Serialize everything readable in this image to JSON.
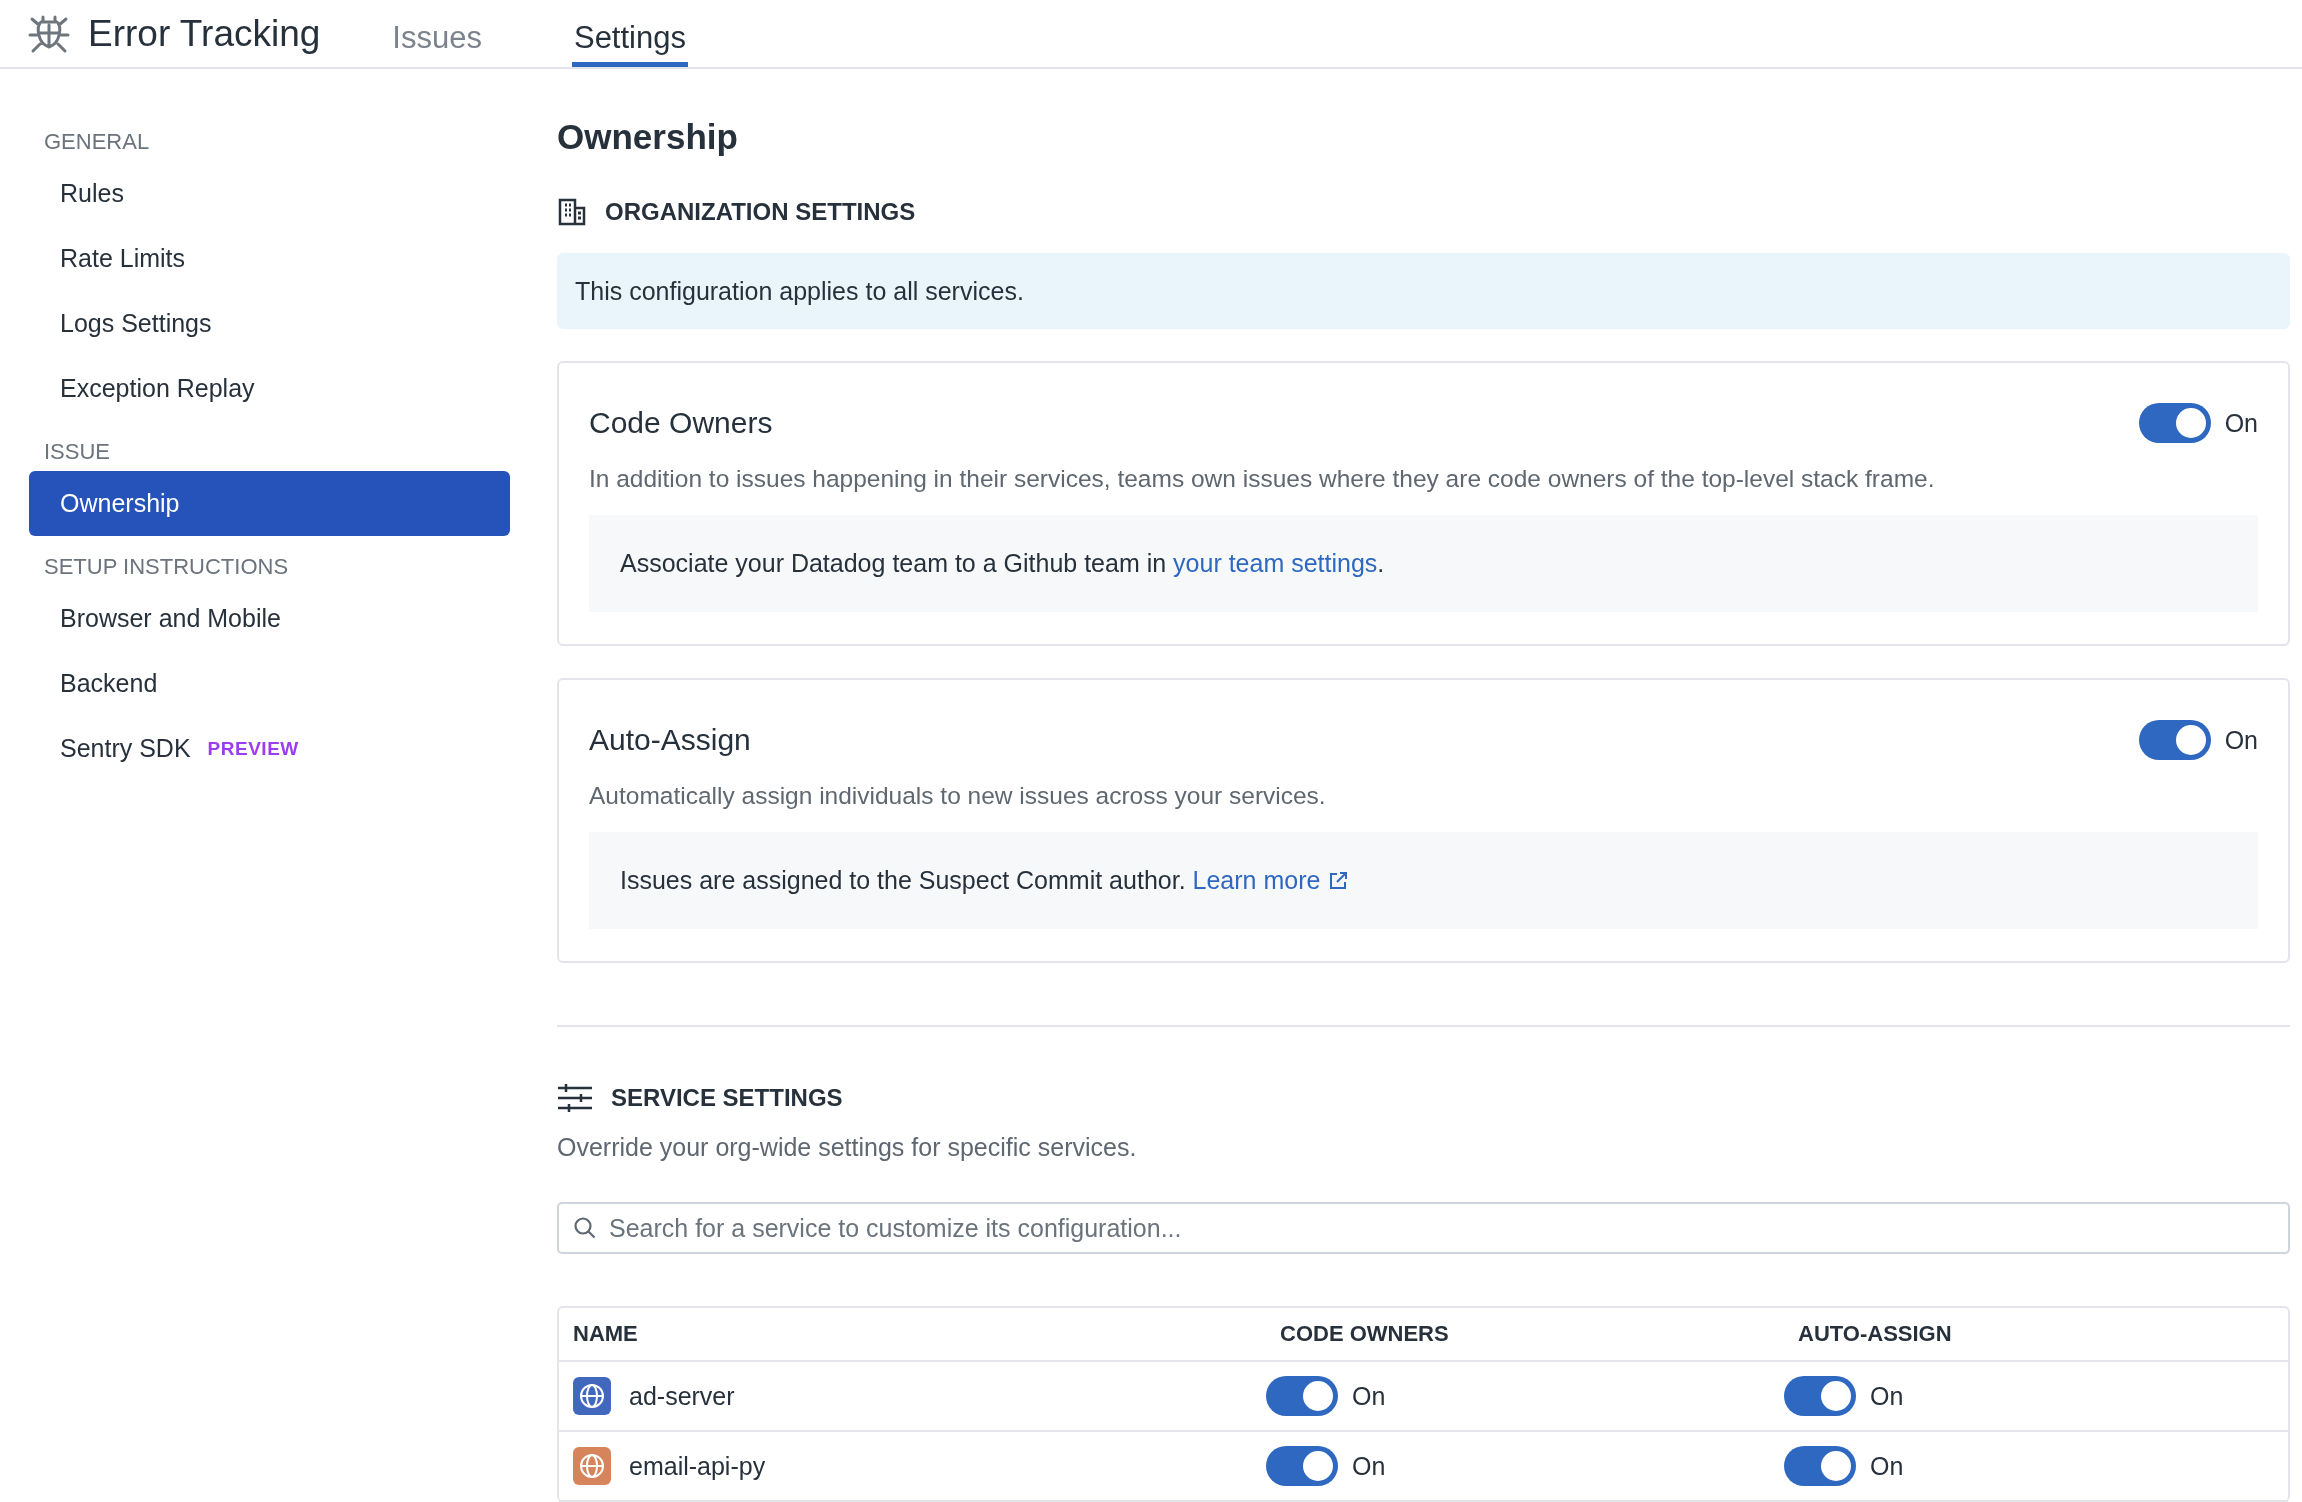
{
  "app": {
    "title": "Error Tracking"
  },
  "tabs": [
    {
      "label": "Issues",
      "selected": false
    },
    {
      "label": "Settings",
      "selected": true
    }
  ],
  "sidebar": {
    "sections": [
      {
        "heading": "GENERAL",
        "items": [
          {
            "label": "Rules",
            "selected": false
          },
          {
            "label": "Rate Limits",
            "selected": false
          },
          {
            "label": "Logs Settings",
            "selected": false
          },
          {
            "label": "Exception Replay",
            "selected": false
          }
        ]
      },
      {
        "heading": "ISSUE",
        "items": [
          {
            "label": "Ownership",
            "selected": true
          }
        ]
      },
      {
        "heading": "SETUP INSTRUCTIONS",
        "items": [
          {
            "label": "Browser and Mobile",
            "selected": false
          },
          {
            "label": "Backend",
            "selected": false
          },
          {
            "label": "Sentry SDK",
            "selected": false,
            "badge": "PREVIEW"
          }
        ]
      }
    ]
  },
  "page": {
    "title": "Ownership"
  },
  "org_settings": {
    "heading": "ORGANIZATION SETTINGS",
    "notice": "This configuration applies to all services.",
    "cards": [
      {
        "title": "Code Owners",
        "on": true,
        "toggle_label": "On",
        "description": "In addition to issues happening in their services, teams own issues where they are code owners of the top-level stack frame.",
        "note": "Associate your Datadog team to a Github team in ",
        "link": "your team settings",
        "note_end": ".",
        "external": false
      },
      {
        "title": "Auto-Assign",
        "on": true,
        "toggle_label": "On",
        "description": "Automatically assign individuals to new issues across your services.",
        "note": "Issues are assigned to the Suspect Commit author. ",
        "link": "Learn more",
        "external": true
      }
    ]
  },
  "service_settings": {
    "heading": "SERVICE SETTINGS",
    "description": "Override your org-wide settings for specific services.",
    "search": {
      "placeholder": "Search for a service to customize its configuration..."
    },
    "table": {
      "columns": [
        "NAME",
        "CODE OWNERS",
        "AUTO-ASSIGN"
      ],
      "rows": [
        {
          "name": "ad-server",
          "color": "#4268bd",
          "code_owners": {
            "on": true,
            "label": "On"
          },
          "auto_assign": {
            "on": true,
            "label": "On"
          }
        },
        {
          "name": "email-api-py",
          "color": "#d6845b",
          "code_owners": {
            "on": true,
            "label": "On"
          },
          "auto_assign": {
            "on": true,
            "label": "On"
          }
        }
      ]
    }
  }
}
